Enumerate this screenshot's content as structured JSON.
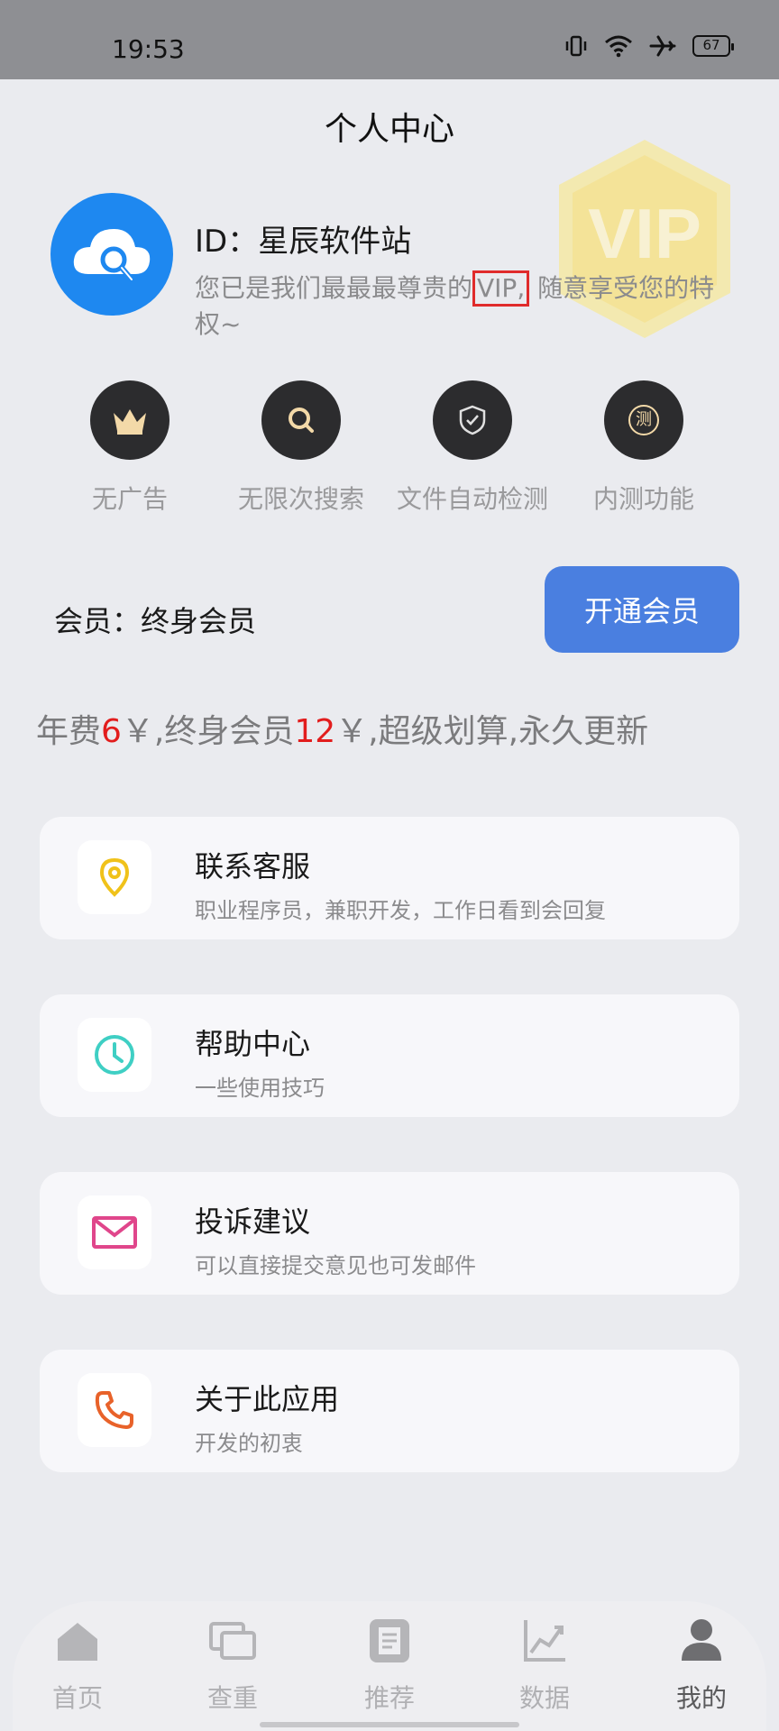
{
  "status": {
    "time": "19:53",
    "battery": "67"
  },
  "header": {
    "title": "个人中心"
  },
  "badge": {
    "text": "VIP"
  },
  "profile": {
    "id_text": "ID：星辰软件站",
    "desc_before": "您已是我们最最最尊贵的",
    "desc_vip": "VIP,",
    "desc_after": " 随意享受您的特权~"
  },
  "features": [
    {
      "label": "无广告",
      "icon": "crown-icon"
    },
    {
      "label": "无限次搜索",
      "icon": "search-icon"
    },
    {
      "label": "文件自动检测",
      "icon": "shield-check-icon"
    },
    {
      "label": "内测功能",
      "icon": "test-icon",
      "glyph": "测"
    }
  ],
  "membership": {
    "status_text": "会员：终身会员",
    "open_button": "开通会员"
  },
  "pricing": {
    "p1": "年费",
    "p2": "6",
    "p3": "￥,终身会员",
    "p4": "12",
    "p5": "￥,超级划算,永久更新"
  },
  "cards": [
    {
      "title": "联系客服",
      "subtitle": "职业程序员，兼职开发，工作日看到会回复",
      "icon": "location-pin-icon",
      "color": "#f0c21a"
    },
    {
      "title": "帮助中心",
      "subtitle": "一些使用技巧",
      "icon": "clock-icon",
      "color": "#3fcfc4"
    },
    {
      "title": "投诉建议",
      "subtitle": "可以直接提交意见也可发邮件",
      "icon": "mail-icon",
      "color": "#e0468b"
    },
    {
      "title": "关于此应用",
      "subtitle": "开发的初衷",
      "icon": "phone-icon",
      "color": "#e8622a"
    }
  ],
  "nav": [
    {
      "label": "首页",
      "icon": "home-icon"
    },
    {
      "label": "查重",
      "icon": "duplicate-check-icon"
    },
    {
      "label": "推荐",
      "icon": "recommend-icon"
    },
    {
      "label": "数据",
      "icon": "chart-icon"
    },
    {
      "label": "我的",
      "icon": "profile-icon",
      "active": true
    }
  ]
}
